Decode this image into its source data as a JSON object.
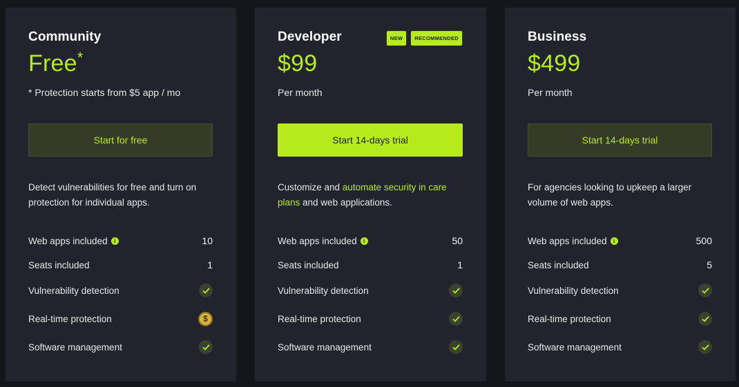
{
  "plans": [
    {
      "name": "Community",
      "price": "Free",
      "price_suffix": "*",
      "note": "* Protection starts from $5 app / mo",
      "cta": "Start for free",
      "desc_parts": [
        "Detect vulnerabilities for free and turn on protection for individual apps.",
        "",
        ""
      ],
      "features": [
        {
          "label": "Web apps included",
          "value": "10",
          "icon": "info-icon"
        },
        {
          "label": "Seats included",
          "value": "1"
        },
        {
          "label": "Vulnerability detection",
          "indicator": "check-icon"
        },
        {
          "label": "Real-time protection",
          "indicator": "dollar-icon"
        },
        {
          "label": "Software management",
          "indicator": "check-icon"
        }
      ]
    },
    {
      "name": "Developer",
      "badges": [
        "NEW",
        "RECOMMENDED"
      ],
      "price": "$99",
      "note": "Per month",
      "cta": "Start 14-days trial",
      "desc_parts": [
        "Customize and ",
        "automate security in care plans",
        " and web applications."
      ],
      "features": [
        {
          "label": "Web apps included",
          "value": "50",
          "icon": "info-icon"
        },
        {
          "label": "Seats included",
          "value": "1"
        },
        {
          "label": "Vulnerability detection",
          "indicator": "check-icon"
        },
        {
          "label": "Real-time protection",
          "indicator": "check-icon"
        },
        {
          "label": "Software management",
          "indicator": "check-icon"
        }
      ]
    },
    {
      "name": "Business",
      "price": "$499",
      "note": "Per month",
      "cta": "Start 14-days trial",
      "desc_parts": [
        "For agencies looking to upkeep a larger volume of web apps.",
        "",
        ""
      ],
      "features": [
        {
          "label": "Web apps included",
          "value": "500",
          "icon": "info-icon"
        },
        {
          "label": "Seats included",
          "value": "5"
        },
        {
          "label": "Vulnerability detection",
          "indicator": "check-icon"
        },
        {
          "label": "Real-time protection",
          "indicator": "check-icon"
        },
        {
          "label": "Software management",
          "indicator": "check-icon"
        }
      ]
    }
  ],
  "colors": {
    "accent": "#b8eb1e",
    "card": "#21242c",
    "background": "#14161b"
  }
}
